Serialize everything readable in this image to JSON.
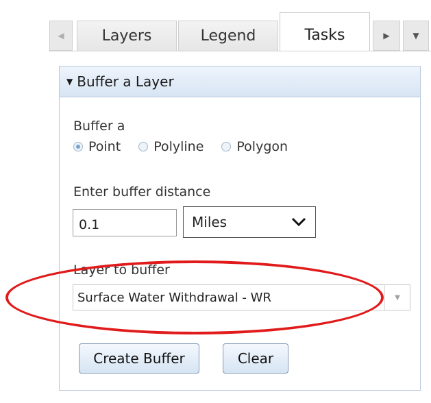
{
  "tabs": {
    "items": [
      {
        "label": "Layers"
      },
      {
        "label": "Legend"
      },
      {
        "label": "Tasks",
        "active": true
      }
    ]
  },
  "panel": {
    "title": "Buffer a Layer",
    "buffer_label": "Buffer a",
    "geometry_options": [
      {
        "label": "Point",
        "checked": true
      },
      {
        "label": "Polyline",
        "checked": false
      },
      {
        "label": "Polygon",
        "checked": false
      }
    ],
    "distance_label": "Enter buffer distance",
    "distance_value": "0.1",
    "unit_value": "Miles",
    "layer_label": "Layer to buffer",
    "layer_value": "Surface Water Withdrawal - WR",
    "create_button": "Create Buffer",
    "clear_button": "Clear"
  },
  "colors": {
    "highlight": "#e11b1b",
    "header_bg": "#d7e5f4"
  }
}
